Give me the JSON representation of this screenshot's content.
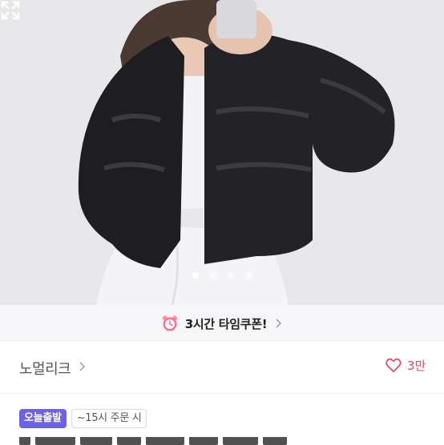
{
  "product_image": {
    "alt": "black leather puffer jacket photo",
    "carousel_count": 4,
    "active_index": 0
  },
  "coupon_banner": {
    "label": "3시간 타임쿠폰!",
    "icon": "alarm-clock-icon"
  },
  "shop": {
    "name": "노멀리크",
    "likes": "3만"
  },
  "badges": {
    "delivery": "오늘출발",
    "order_deadline": "~15시 주문 시"
  },
  "colors": {
    "accent": "#6b62e8",
    "like": "#e8435a",
    "coupon_bg": "#f6f6f8"
  }
}
